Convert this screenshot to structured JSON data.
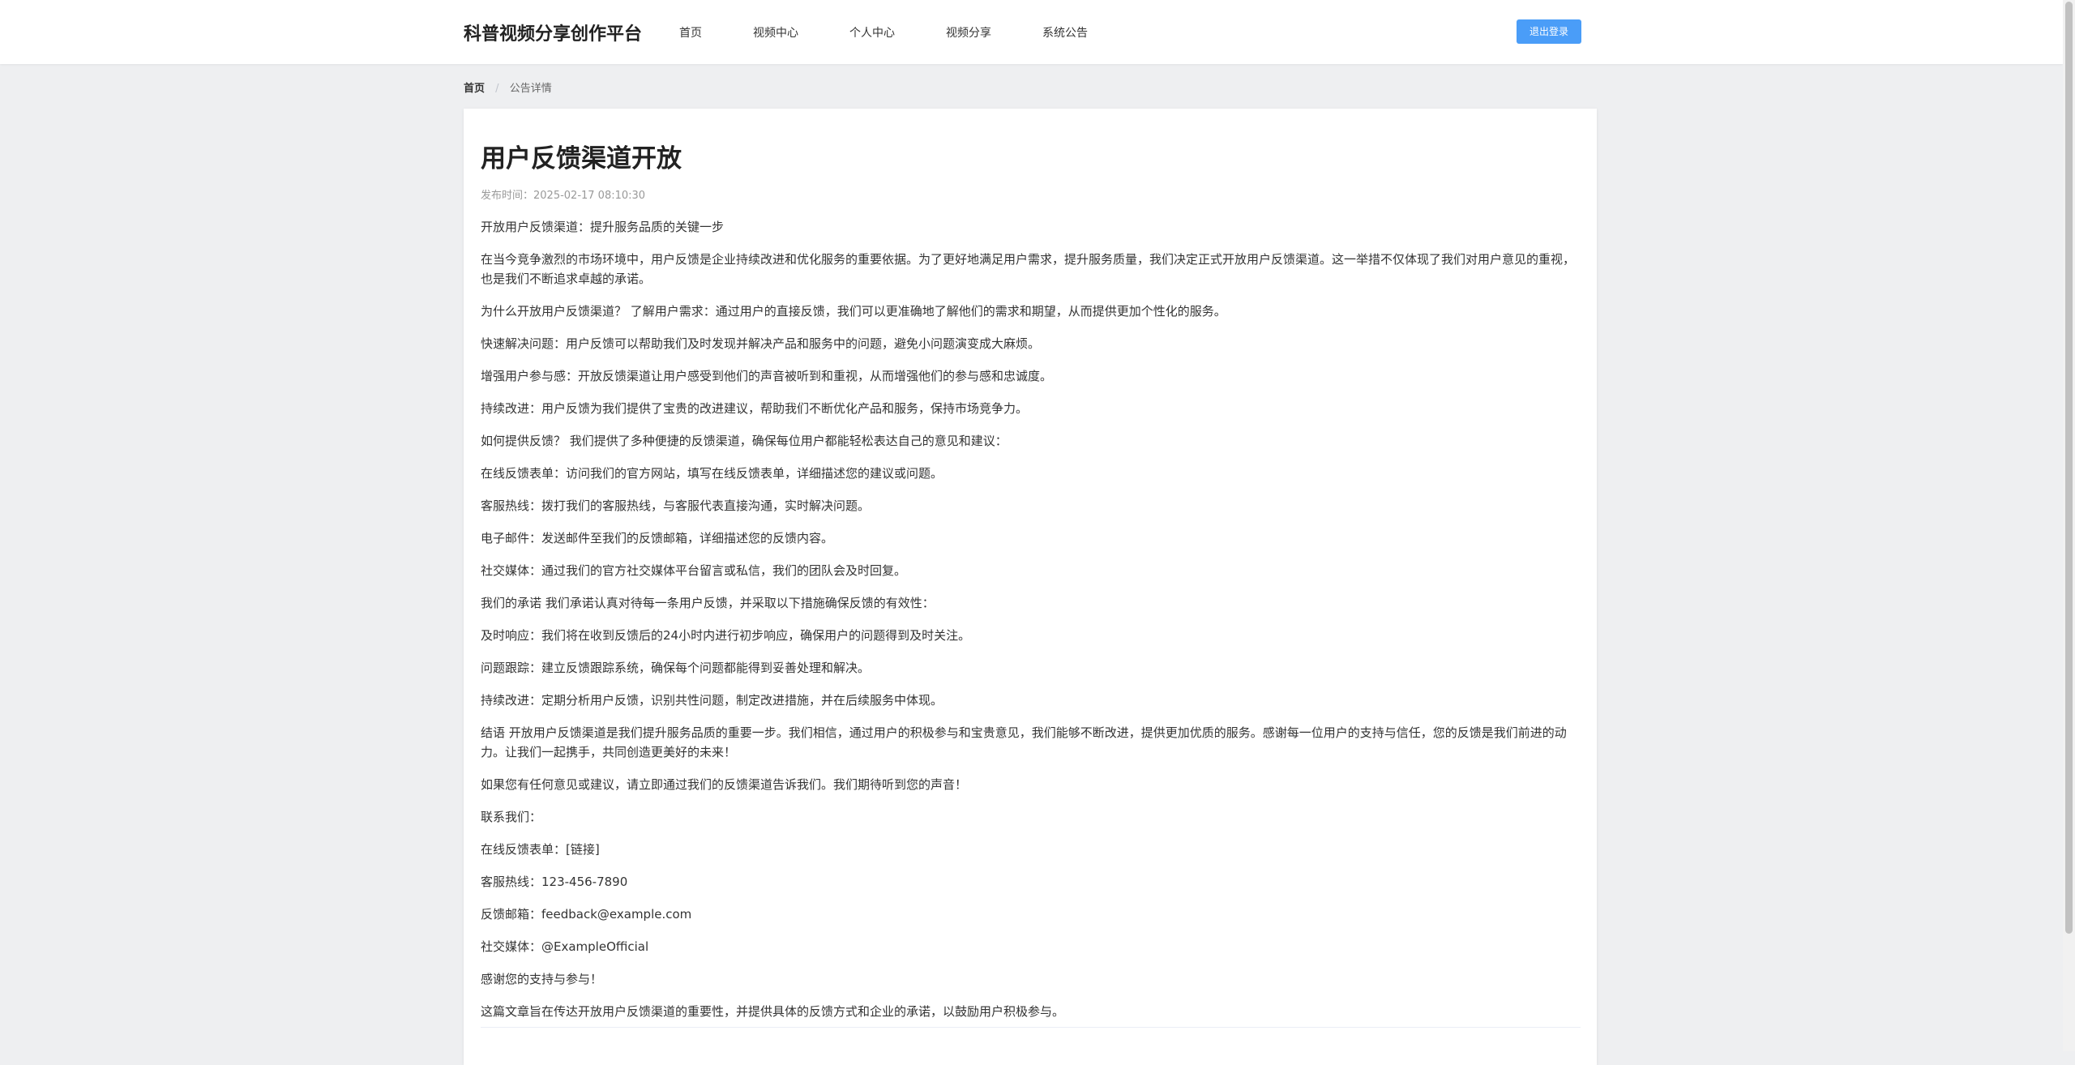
{
  "header": {
    "brand": "科普视频分享创作平台",
    "nav": [
      {
        "label": "首页"
      },
      {
        "label": "视频中心"
      },
      {
        "label": "个人中心"
      },
      {
        "label": "视频分享"
      },
      {
        "label": "系统公告"
      }
    ],
    "logout_label": "退出登录"
  },
  "breadcrumb": {
    "home": "首页",
    "separator": "/",
    "current": "公告详情"
  },
  "article": {
    "title": "用户反馈渠道开放",
    "meta": "发布时间：2025-02-17 08:10:30",
    "paragraphs": [
      "开放用户反馈渠道：提升服务品质的关键一步",
      "在当今竞争激烈的市场环境中，用户反馈是企业持续改进和优化服务的重要依据。为了更好地满足用户需求，提升服务质量，我们决定正式开放用户反馈渠道。这一举措不仅体现了我们对用户意见的重视，也是我们不断追求卓越的承诺。",
      "为什么开放用户反馈渠道？ 了解用户需求：通过用户的直接反馈，我们可以更准确地了解他们的需求和期望，从而提供更加个性化的服务。",
      "快速解决问题：用户反馈可以帮助我们及时发现并解决产品和服务中的问题，避免小问题演变成大麻烦。",
      "增强用户参与感：开放反馈渠道让用户感受到他们的声音被听到和重视，从而增强他们的参与感和忠诚度。",
      "持续改进：用户反馈为我们提供了宝贵的改进建议，帮助我们不断优化产品和服务，保持市场竞争力。",
      "如何提供反馈？ 我们提供了多种便捷的反馈渠道，确保每位用户都能轻松表达自己的意见和建议：",
      "在线反馈表单：访问我们的官方网站，填写在线反馈表单，详细描述您的建议或问题。",
      "客服热线：拨打我们的客服热线，与客服代表直接沟通，实时解决问题。",
      "电子邮件：发送邮件至我们的反馈邮箱，详细描述您的反馈内容。",
      "社交媒体：通过我们的官方社交媒体平台留言或私信，我们的团队会及时回复。",
      "我们的承诺 我们承诺认真对待每一条用户反馈，并采取以下措施确保反馈的有效性：",
      "及时响应：我们将在收到反馈后的24小时内进行初步响应，确保用户的问题得到及时关注。",
      "问题跟踪：建立反馈跟踪系统，确保每个问题都能得到妥善处理和解决。",
      "持续改进：定期分析用户反馈，识别共性问题，制定改进措施，并在后续服务中体现。",
      "结语 开放用户反馈渠道是我们提升服务品质的重要一步。我们相信，通过用户的积极参与和宝贵意见，我们能够不断改进，提供更加优质的服务。感谢每一位用户的支持与信任，您的反馈是我们前进的动力。让我们一起携手，共同创造更美好的未来！",
      "如果您有任何意见或建议，请立即通过我们的反馈渠道告诉我们。我们期待听到您的声音！",
      "联系我们：",
      "在线反馈表单：[链接]",
      "客服热线：123-456-7890",
      "反馈邮箱：feedback@example.com",
      "社交媒体：@ExampleOfficial",
      "感谢您的支持与参与！",
      "这篇文章旨在传达开放用户反馈渠道的重要性，并提供具体的反馈方式和企业的承诺，以鼓励用户积极参与。"
    ]
  },
  "colors": {
    "primary": "#4a9df8",
    "page_background": "#eeeff1",
    "card_background": "#ffffff"
  }
}
